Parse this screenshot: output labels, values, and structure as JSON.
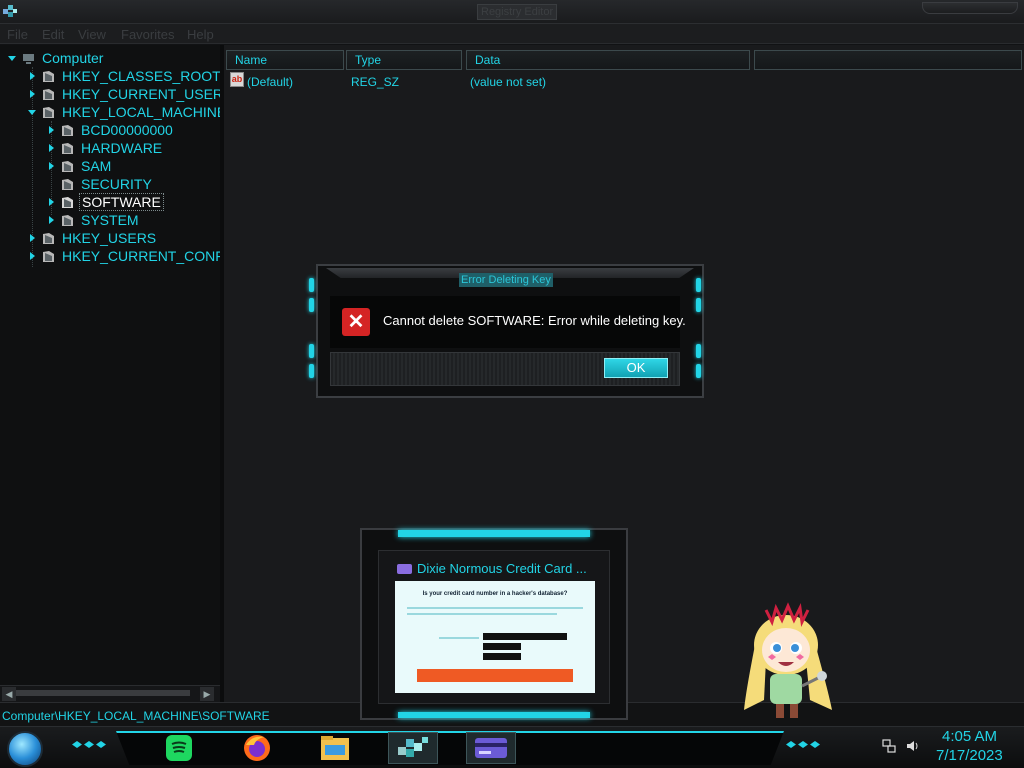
{
  "window": {
    "title": "Registry Editor"
  },
  "menu": [
    "File",
    "Edit",
    "View",
    "Favorites",
    "Help"
  ],
  "tree": {
    "root": "Computer",
    "items": [
      {
        "label": "HKEY_CLASSES_ROOT",
        "level": 1
      },
      {
        "label": "HKEY_CURRENT_USER",
        "level": 1
      },
      {
        "label": "HKEY_LOCAL_MACHINE",
        "level": 1,
        "expanded": true
      },
      {
        "label": "BCD00000000",
        "level": 2
      },
      {
        "label": "HARDWARE",
        "level": 2
      },
      {
        "label": "SAM",
        "level": 2
      },
      {
        "label": "SECURITY",
        "level": 2
      },
      {
        "label": "SOFTWARE",
        "level": 2,
        "selected": true
      },
      {
        "label": "SYSTEM",
        "level": 2
      },
      {
        "label": "HKEY_USERS",
        "level": 1
      },
      {
        "label": "HKEY_CURRENT_CONFI",
        "level": 1
      }
    ]
  },
  "list": {
    "columns": [
      "Name",
      "Type",
      "Data"
    ],
    "rows": [
      {
        "name": "(Default)",
        "type": "REG_SZ",
        "data": "(value not set)",
        "icon": "reg-sz-icon"
      }
    ]
  },
  "status": {
    "path": "Computer\\HKEY_LOCAL_MACHINE\\SOFTWARE"
  },
  "dialog": {
    "title": "Error Deleting Key",
    "message": "Cannot delete SOFTWARE:  Error while deleting key.",
    "ok_label": "OK",
    "icon": "error-icon"
  },
  "thumbnail": {
    "title": "Dixie Normous Credit Card ...",
    "headline": "Is your credit card number in a hacker's database?"
  },
  "taskbar": {
    "apps": [
      "spotify-icon",
      "firefox-icon",
      "file-explorer-icon",
      "registry-editor-icon",
      "credit-card-app-icon"
    ],
    "time": "4:05 AM",
    "date": "7/17/2023"
  },
  "colors": {
    "accent": "#22d4e6",
    "background": "#111214",
    "error": "#d42424"
  }
}
